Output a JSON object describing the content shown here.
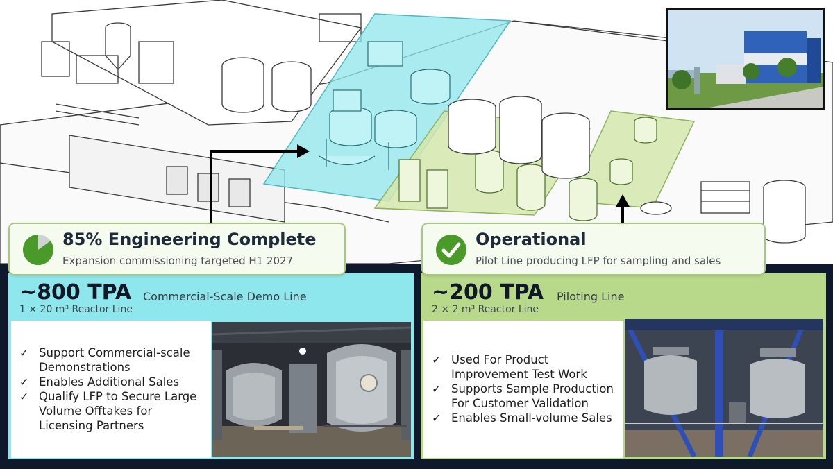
{
  "status_left": {
    "title": "85% Engineering Complete",
    "subtitle": "Expansion commissioning targeted H1 2027",
    "progress": 0.85,
    "icon": "progress-pie-icon"
  },
  "status_right": {
    "title": "Operational",
    "subtitle": "Pilot Line producing LFP for sampling and sales",
    "icon": "check-circle-icon"
  },
  "panel_left": {
    "capacity": "~800 TPA",
    "line_name": "Commercial-Scale Demo Line",
    "reactor": "1 × 20 m³ Reactor Line",
    "bullets": [
      "Support Commercial-scale Demonstrations",
      "Enables Additional Sales",
      "Qualify LFP to Secure Large Volume Offtakes for Licensing Partners"
    ]
  },
  "panel_right": {
    "capacity": "~200 TPA",
    "line_name": "Piloting Line",
    "reactor": "2 × 2 m³ Reactor Line",
    "bullets": [
      "Used For Product Improvement Test Work",
      "Supports Sample Production For Customer Validation",
      "Enables Small-volume Sales"
    ]
  },
  "colors": {
    "cyan_zone": "#8fe6ec",
    "green_zone": "#d3e6ad",
    "left_panel_bg": "#8fe7ee",
    "right_panel_bg": "#b9d98a",
    "card_border": "#a7c97c",
    "status_green": "#4a9a2a",
    "dark_band": "#0e1a2b"
  }
}
